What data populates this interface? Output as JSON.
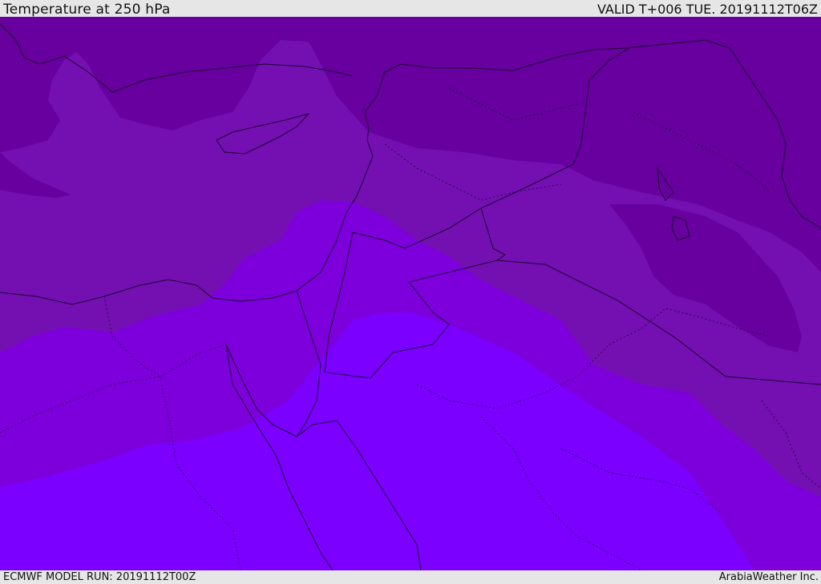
{
  "header": {
    "title": "Temperature at 250 hPa",
    "valid": "VALID T+006 TUE. 20191112T06Z"
  },
  "footer": {
    "model_run": "ECMWF MODEL RUN: 20191112T00Z",
    "credit": "ArabiaWeather Inc."
  },
  "colors": {
    "band_coldest": "#67009e",
    "band_cold": "#7410b2",
    "band_mid": "#7d00dc",
    "band_warm": "#7b00ff",
    "boundary_line": "#1a0030"
  }
}
